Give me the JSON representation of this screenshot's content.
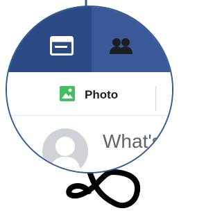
{
  "navbar": {
    "tabs": [
      {
        "icon": "news-feed-icon",
        "active": true
      },
      {
        "icon": "friends-icon",
        "active": false
      }
    ]
  },
  "toolbar": {
    "photo_label": "Photo"
  },
  "composer": {
    "placeholder": "What's"
  },
  "colors": {
    "brand_blue": "#3b5998",
    "active_tab": "#2c4a86",
    "photo_green": "#45bd62"
  }
}
